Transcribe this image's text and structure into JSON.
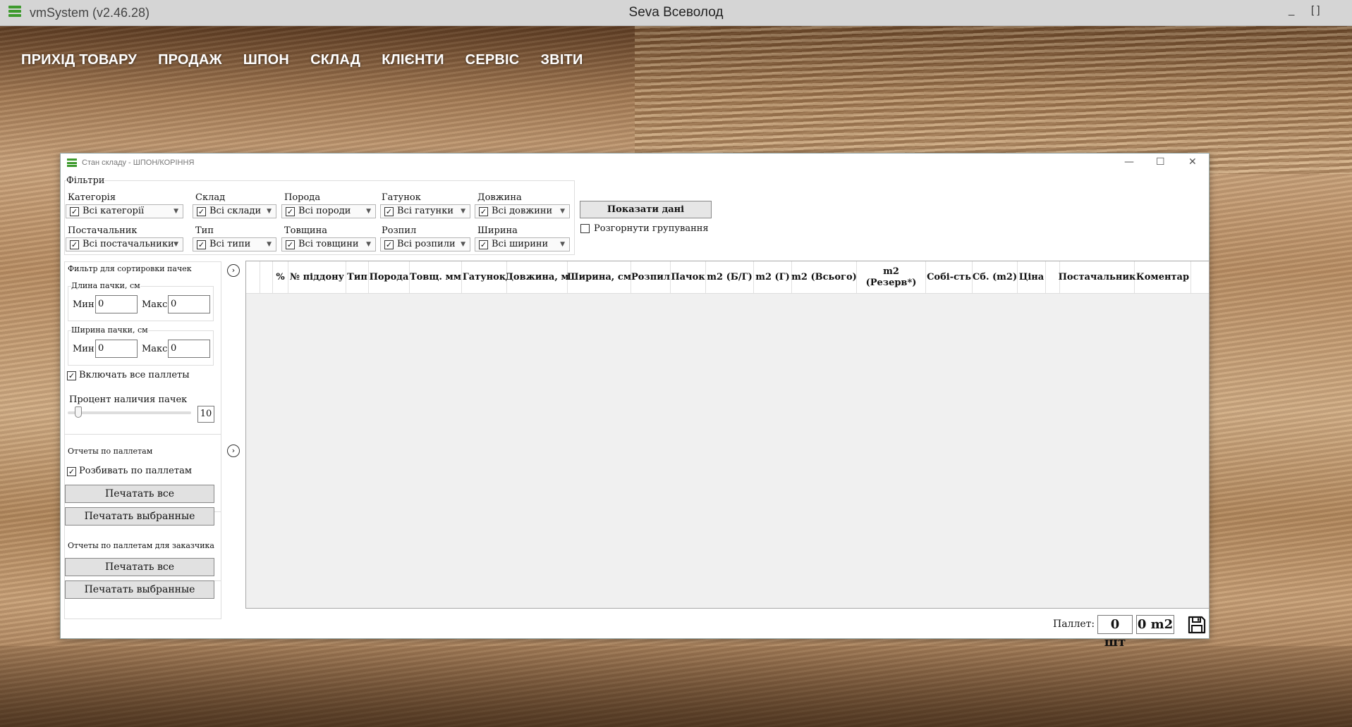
{
  "app": {
    "name": "vmSystem (v2.46.28)",
    "user": "Seva Всеволод",
    "minimize": "_",
    "maximize": "[ ]"
  },
  "menu": [
    "ПРИХІД ТОВАРУ",
    "ПРОДАЖ",
    "ШПОН",
    "СКЛАД",
    "КЛІЄНТИ",
    "СЕРВІС",
    "ЗВІТИ"
  ],
  "window": {
    "title": "Стан складу - ШПОН/КОРІННЯ",
    "minimize": "—",
    "maximize": "☐",
    "close": "✕"
  },
  "filters": {
    "legend": "Фільтри",
    "category": {
      "label": "Категорія",
      "value": "Всі категорії"
    },
    "warehouse": {
      "label": "Склад",
      "value": "Всі склади"
    },
    "species": {
      "label": "Порода",
      "value": "Всі породи"
    },
    "grade": {
      "label": "Гатунок",
      "value": "Всі гатунки"
    },
    "length": {
      "label": "Довжина",
      "value": "Всі довжини"
    },
    "supplier": {
      "label": "Постачальник",
      "value": "Всі постачальники"
    },
    "type": {
      "label": "Тип",
      "value": "Всі типи"
    },
    "thickness": {
      "label": "Товщина",
      "value": "Всі товщини"
    },
    "cut": {
      "label": "Розпил",
      "value": "Всі розпили"
    },
    "width": {
      "label": "Ширина",
      "value": "Всі ширини"
    },
    "show_button": "Показати дані",
    "expand_grouping": "Розгорнути групування"
  },
  "sort_filter": {
    "legend": "Фильтр для сортировки пачек",
    "length_legend": "Длина пачки, см",
    "width_legend": "Ширина пачки, см",
    "min_label": "Мин",
    "max_label": "Макс",
    "length_min": "0",
    "length_max": "0",
    "width_min": "0",
    "width_max": "0",
    "include_all": "Включать все паллеты",
    "percent_label": "Процент наличия пачек",
    "percent_value": "10"
  },
  "pallet_reports": {
    "legend": "Отчеты по паллетам",
    "split_label": "Розбивать по паллетам",
    "print_all": "Печатать все",
    "print_selected": "Печатать выбранные"
  },
  "customer_reports": {
    "legend": "Отчеты по паллетам для заказчика",
    "print_all": "Печатать все",
    "print_selected": "Печатать выбранные"
  },
  "grid": {
    "columns": [
      "",
      "",
      "%",
      "№ піддону",
      "Тип",
      "Порода",
      "Товщ. мм",
      "Гатунок",
      "Довжина, м",
      "Ширина, см",
      "Розпил",
      "Пачок",
      "m2 (Б/Г)",
      "m2 (Г)",
      "m2 (Всього)",
      "m2\n(Резерв*)",
      "Собі-сть",
      "Сб. (m2)",
      "Ціна",
      "",
      "Постачальник",
      "Коментар"
    ]
  },
  "footer": {
    "pallets_label": "Паллет:",
    "count": "0 шт",
    "area": "0 m2"
  },
  "icons": {
    "circle_arrow": "›",
    "check": "✓",
    "dropdown": "▼"
  }
}
